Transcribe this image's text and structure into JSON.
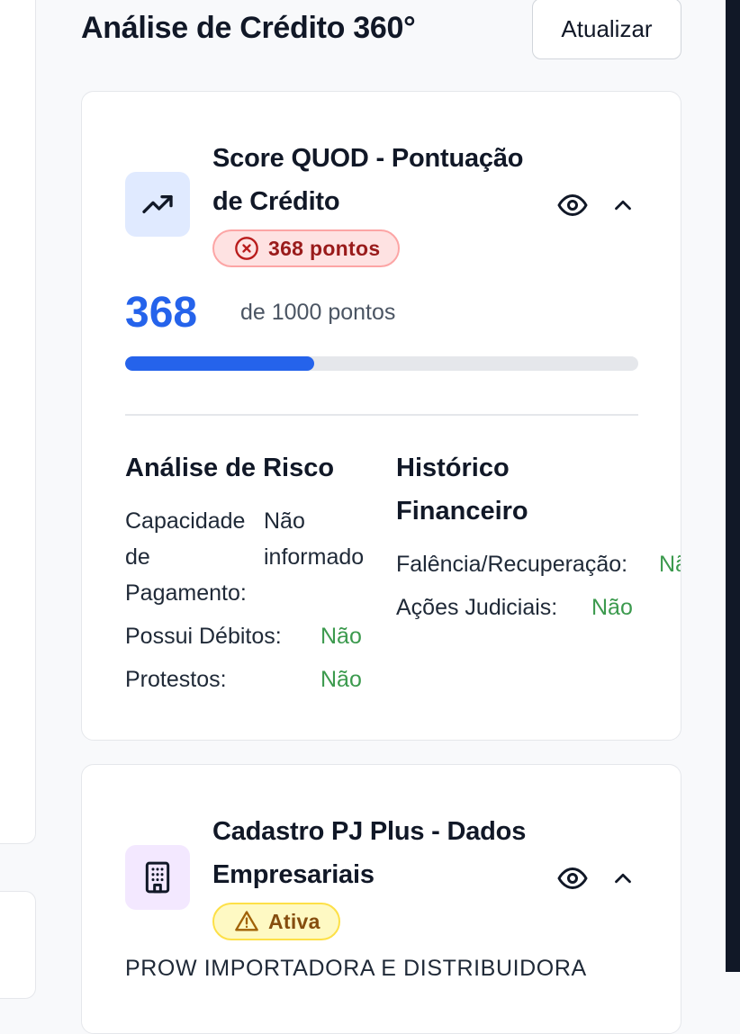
{
  "header": {
    "title": "Análise de Crédito 360°",
    "refresh_label": "Atualizar"
  },
  "score_card": {
    "icon": "trending-up-icon",
    "title_line1": "Score QUOD - Pontuação",
    "title_line2": "de Crédito",
    "badge_icon": "x-circle-icon",
    "badge_label": "368 pontos",
    "score": "368",
    "score_max_label": "de 1000 pontos",
    "progress_fraction": 0.368,
    "risk": {
      "heading": "Análise de Risco",
      "capacity_label_1": "Capacidade",
      "capacity_label_2": "de",
      "capacity_label_3": "Pagamento:",
      "capacity_value_1": "Não",
      "capacity_value_2": "informado",
      "debts_label": "Possui Débitos:",
      "debts_value": "Não",
      "protests_label": "Protestos:",
      "protests_value": "Não"
    },
    "history": {
      "heading_line1": "Histórico",
      "heading_line2": "Financeiro",
      "bankruptcy_label": "Falência/Recuperação:",
      "bankruptcy_value": "Não",
      "lawsuits_label": "Ações Judiciais:",
      "lawsuits_value": "Não"
    }
  },
  "company_card": {
    "icon": "building-icon",
    "title_line1": "Cadastro PJ Plus - Dados",
    "title_line2": "Empresariais",
    "badge_icon": "warning-triangle-icon",
    "badge_label": "Ativa",
    "company_name": "PROW IMPORTADORA E DISTRIBUIDORA"
  },
  "colors": {
    "accent": "#2563eb",
    "success": "#3c9a4e",
    "danger_bg": "#fee2e2",
    "warning_bg": "#fef9c3"
  }
}
